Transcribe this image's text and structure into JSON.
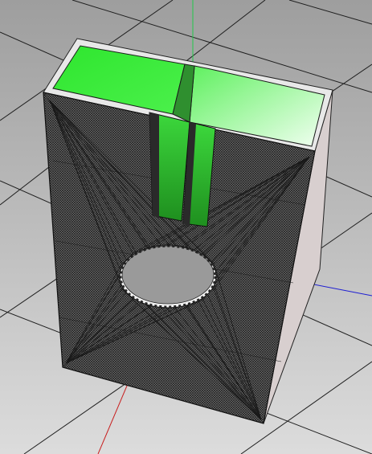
{
  "viewport": {
    "background_top": "#9e9e9e",
    "background_bottom": "#dcdcdc",
    "grid_color": "#1e1e1e"
  },
  "axes": {
    "z_color": "#22c84a",
    "x_color": "#c81e1e",
    "y_color": "#1e1ed2"
  },
  "model": {
    "body_color": "#5e5e5e",
    "mesh_color": "#1a1a1a",
    "rim_color": "#e8e8e8",
    "chamber_color": "#38e838",
    "port_color": "#2a2a2a",
    "driver_color": "#9a9a9a",
    "side_color": "#d8cfcf"
  }
}
